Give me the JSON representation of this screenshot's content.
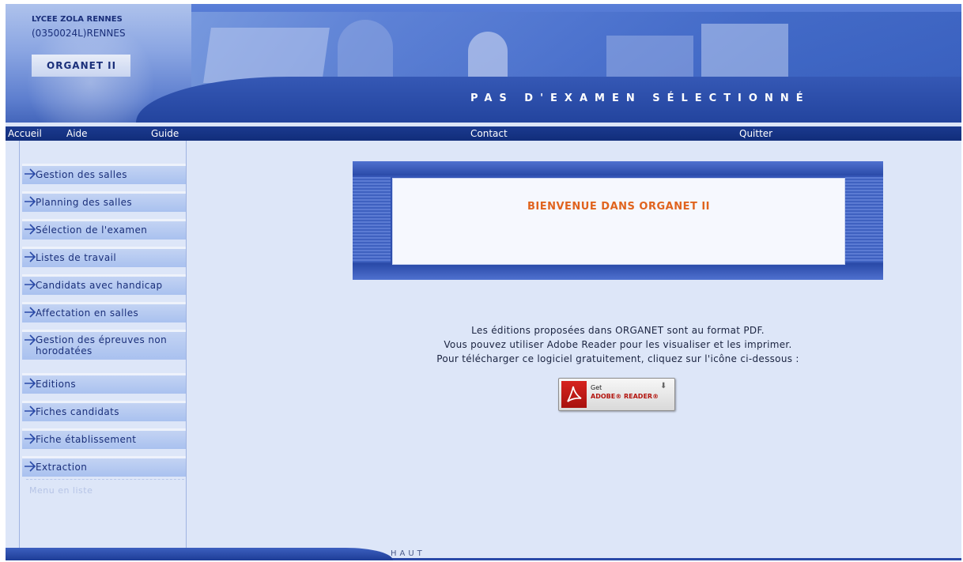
{
  "header": {
    "school_name": "LYCEE ZOLA RENNES",
    "school_code": "(0350024L)RENNES",
    "app_name": "ORGANET II",
    "exam_status": "PAS D'EXAMEN SÉLECTIONNÉ"
  },
  "nav": {
    "accueil": "Accueil",
    "aide": "Aide",
    "guide": "Guide",
    "contact": "Contact",
    "quitter": "Quitter"
  },
  "sidebar": {
    "items": [
      {
        "label": "Gestion des salles"
      },
      {
        "label": "Planning des salles"
      },
      {
        "label": "Sélection de l'examen"
      },
      {
        "label": "Listes de travail"
      },
      {
        "label": "Candidats avec handicap"
      },
      {
        "label": "Affectation en salles"
      },
      {
        "label": "Gestion des épreuves non horodatées"
      },
      {
        "label": "Editions"
      },
      {
        "label": "Fiches candidats"
      },
      {
        "label": "Fiche établissement"
      },
      {
        "label": "Extraction"
      }
    ],
    "list_link": "Menu en liste"
  },
  "main": {
    "welcome": "BIENVENUE DANS ORGANET II",
    "info_lines": [
      "Les éditions proposées dans ORGANET sont au format PDF.",
      "Vous pouvez utiliser Adobe Reader pour les visualiser et les imprimer.",
      "Pour télécharger ce logiciel gratuitement, cliquez sur l'icône ci-dessous :"
    ],
    "reader_button": {
      "get": "Get",
      "name": "ADOBE® READER®",
      "icon": "adobe-reader-icon"
    }
  },
  "footer": {
    "haut": "HAUT"
  },
  "colors": {
    "header_blue": "#2a4ea8",
    "nav_blue": "#112d7a",
    "welcome_orange": "#e0641e",
    "background": "#dde6f8"
  }
}
